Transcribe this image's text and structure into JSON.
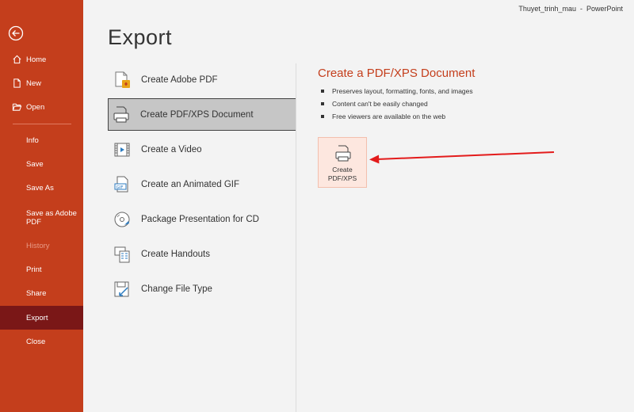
{
  "window": {
    "file_name": "Thuyet_trinh_mau",
    "separator": "-",
    "app_name": "PowerPoint"
  },
  "sidebar": {
    "items": [
      {
        "label": "Home",
        "icon": "home-icon"
      },
      {
        "label": "New",
        "icon": "new-document-icon"
      },
      {
        "label": "Open",
        "icon": "folder-open-icon"
      },
      {
        "label": "Info"
      },
      {
        "label": "Save"
      },
      {
        "label": "Save As"
      },
      {
        "label": "Save as Adobe PDF"
      },
      {
        "label": "History",
        "disabled": true
      },
      {
        "label": "Print"
      },
      {
        "label": "Share"
      },
      {
        "label": "Export",
        "active": true
      },
      {
        "label": "Close"
      }
    ]
  },
  "page": {
    "title": "Export"
  },
  "options": [
    {
      "label": "Create Adobe PDF",
      "icon": "adobe-pdf-icon"
    },
    {
      "label": "Create PDF/XPS Document",
      "icon": "pdf-xps-icon",
      "selected": true
    },
    {
      "label": "Create a Video",
      "icon": "video-icon"
    },
    {
      "label": "Create an Animated GIF",
      "icon": "gif-icon"
    },
    {
      "label": "Package Presentation for CD",
      "icon": "cd-icon"
    },
    {
      "label": "Create Handouts",
      "icon": "handouts-icon"
    },
    {
      "label": "Change File Type",
      "icon": "change-file-type-icon"
    }
  ],
  "detail": {
    "title": "Create a PDF/XPS Document",
    "bullets": [
      "Preserves layout, formatting, fonts, and images",
      "Content can't be easily changed",
      "Free viewers are available on the web"
    ],
    "button_label": "Create\nPDF/XPS"
  },
  "colors": {
    "accent": "#c43e1c",
    "active_nav": "#7a1717",
    "annotation_arrow": "#e31b1b"
  }
}
